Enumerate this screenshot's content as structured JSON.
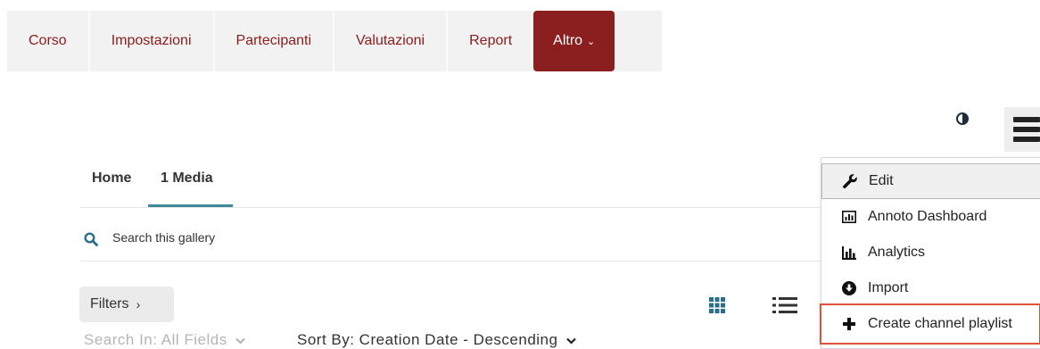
{
  "topnav": {
    "items": [
      {
        "label": "Corso"
      },
      {
        "label": "Impostazioni"
      },
      {
        "label": "Partecipanti"
      },
      {
        "label": "Valutazioni"
      },
      {
        "label": "Report"
      }
    ],
    "more": {
      "label": "Altro",
      "chevron": "⌄"
    },
    "colors": {
      "brand": "#8b1f1f",
      "bar": "#f2f2f2"
    }
  },
  "header_controls": {
    "contrast_icon": "contrast-icon",
    "menu_icon": "hamburger-icon"
  },
  "tabs": [
    {
      "label": "Home"
    },
    {
      "label": "1 Media",
      "active": true
    }
  ],
  "search": {
    "placeholder": "Search this gallery",
    "value": ""
  },
  "filters": {
    "label": "Filters",
    "chevron": "›"
  },
  "search_in": {
    "label": "Search In: All Fields"
  },
  "sort_by": {
    "label": "Sort By: Creation Date - Descending"
  },
  "view_toggles": {
    "grid_icon": "grid-view-icon",
    "list_icon": "list-view-icon"
  },
  "dropdown": {
    "items": [
      {
        "label": "Edit",
        "icon": "wrench-icon"
      },
      {
        "label": "Annoto Dashboard",
        "icon": "dashboard-icon"
      },
      {
        "label": "Analytics",
        "icon": "bar-chart-icon"
      },
      {
        "label": "Import",
        "icon": "download-circle-icon"
      },
      {
        "label": "Create channel playlist",
        "icon": "plus-icon"
      }
    ],
    "highlight_color": "#e0533a"
  }
}
